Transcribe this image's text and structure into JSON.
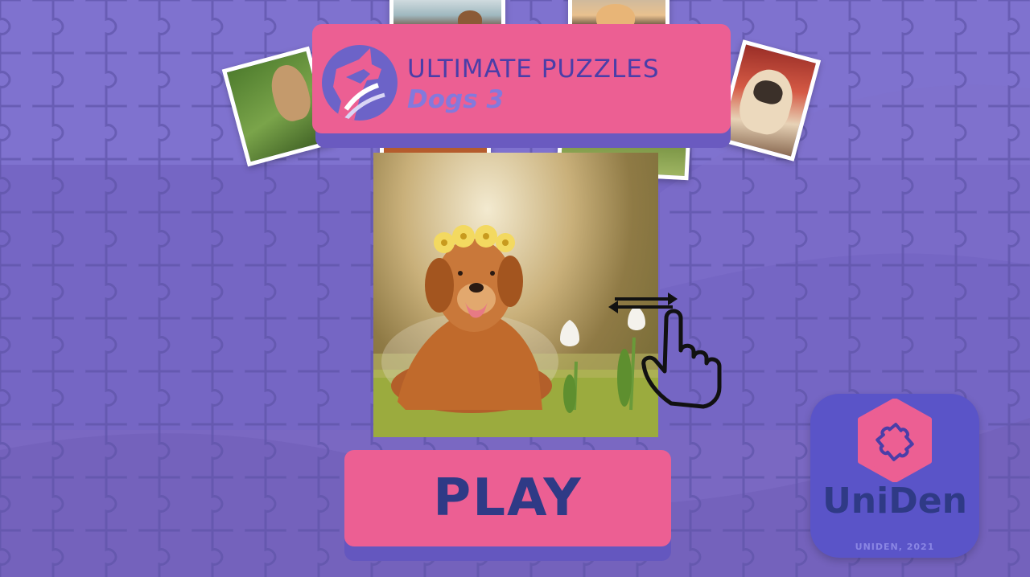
{
  "title": {
    "main": "ULTIMATE PUZZLES",
    "sub": "Dogs 3"
  },
  "play_button": {
    "label": "PLAY"
  },
  "brand": {
    "name": "UniDen",
    "copyright": "UNIDEN, 2021"
  },
  "preview_thumbnails": [
    "bulldog-on-grass",
    "pug-on-blanket",
    "dog-in-snow",
    "shiba-puppy",
    "dog-bottom-left",
    "dog-bottom-right"
  ],
  "main_image": "golden-retriever-with-flower-crown",
  "colors": {
    "background": "#7a6cc9",
    "banner": "#ec5f93",
    "title_text": "#4a3ea8",
    "subtitle_text": "#8479dc",
    "play_text": "#2f3a86",
    "brand_tile": "#5a54c8"
  },
  "icons": {
    "logo": "dog-head-logo-icon",
    "swipe": "swipe-hand-icon",
    "brand": "puzzle-piece-icon"
  }
}
